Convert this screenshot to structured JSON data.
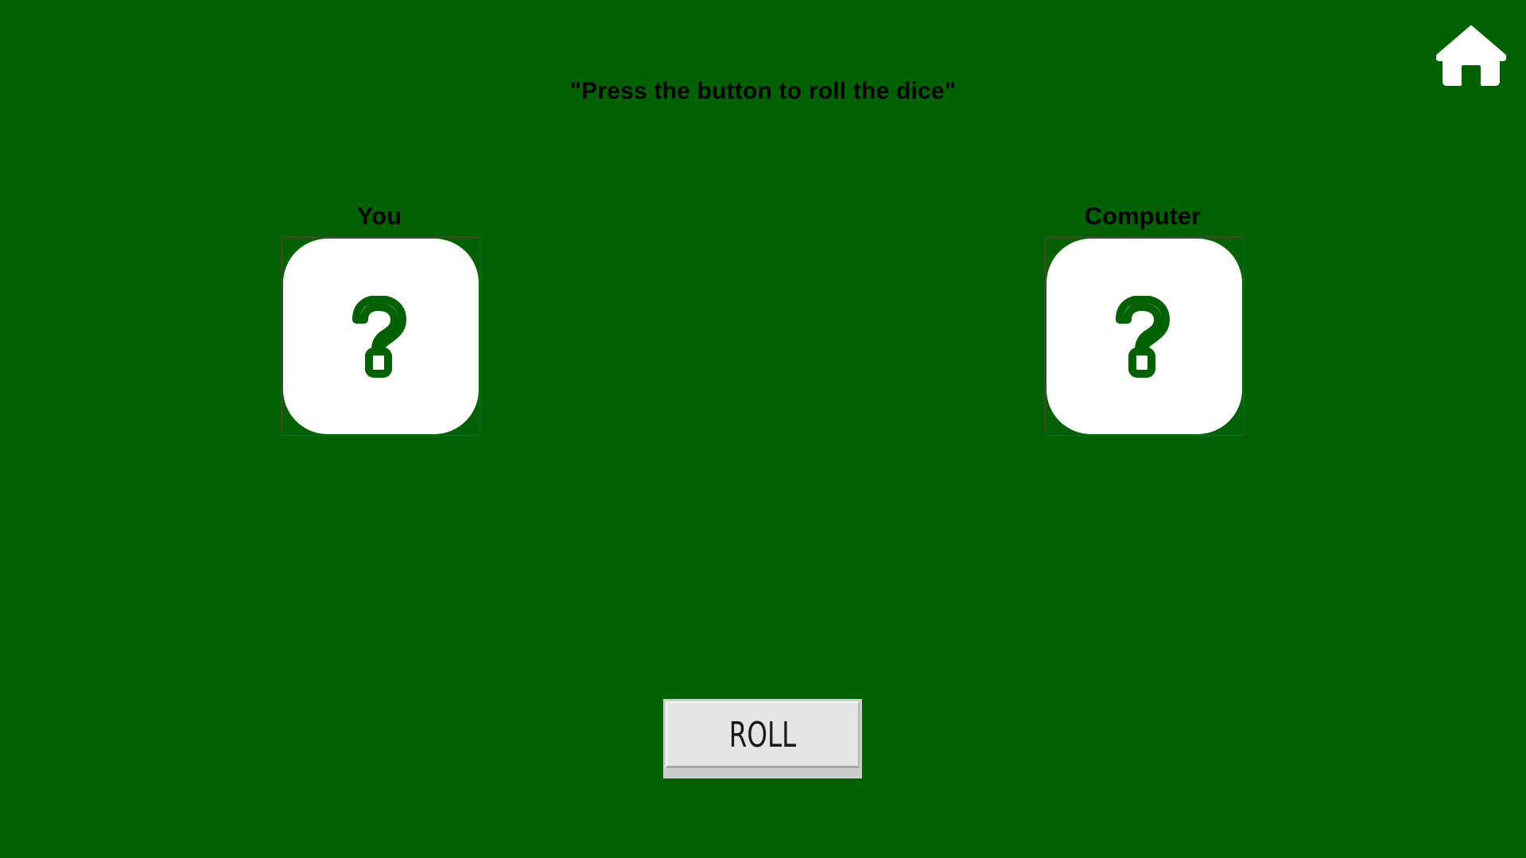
{
  "instruction": "\"Press the button to roll the dice\"",
  "home": {
    "icon": "home-icon"
  },
  "players": [
    {
      "label": "You",
      "die_face": "question-mark-icon"
    },
    {
      "label": "Computer",
      "die_face": "question-mark-icon"
    }
  ],
  "roll_button": {
    "label": "ROLL"
  },
  "colors": {
    "background": "#006100",
    "die": "#ffffff",
    "die_symbol": "#006100",
    "button": "#e4e4e4"
  }
}
